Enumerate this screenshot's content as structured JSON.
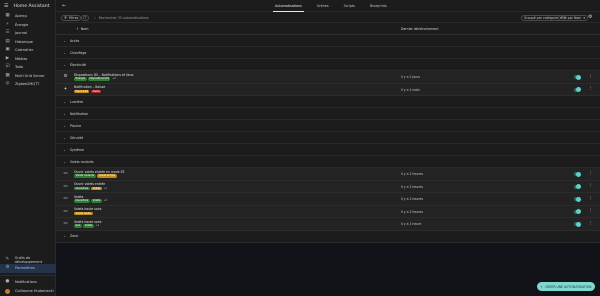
{
  "sidebar": {
    "title": "Home Assistant",
    "items": [
      {
        "label": "Aperçu",
        "icon": "view-dashboard-icon",
        "glyph": "▦"
      },
      {
        "label": "Énergie",
        "icon": "lightning-icon",
        "glyph": "⚡"
      },
      {
        "label": "Journal",
        "icon": "journal-icon",
        "glyph": "☰"
      },
      {
        "label": "Historique",
        "icon": "chart-icon",
        "glyph": "▤"
      },
      {
        "label": "Calendrier",
        "icon": "calendar-icon",
        "glyph": "▣"
      },
      {
        "label": "Médias",
        "icon": "media-icon",
        "glyph": "▶"
      },
      {
        "label": "Todo",
        "icon": "todo-icon",
        "glyph": "☑"
      },
      {
        "label": "Multi Grid Server",
        "icon": "grid-icon",
        "glyph": "▩"
      },
      {
        "label": "Zigbee2MQTT",
        "icon": "zigbee-icon",
        "glyph": "◎"
      }
    ],
    "bottom_items": [
      {
        "label": "Outils de développement",
        "icon": "wrench-icon",
        "glyph": "✎"
      },
      {
        "label": "Paramètres",
        "icon": "gear-icon",
        "glyph": "⚙",
        "active": true
      }
    ],
    "notifications": "Notifications",
    "user": "Guillaume Hudomecki"
  },
  "topbar": {
    "tabs": [
      "Automatisations",
      "Scènes",
      "Scripts",
      "Blueprints"
    ],
    "active_tab": 0
  },
  "filterbar": {
    "filters_label": "Filtres",
    "search_placeholder": "Rechercher 35 automatisations",
    "group_by": "Groupé par catégorie",
    "sort_by": "Trié par Nom"
  },
  "table": {
    "new_label": "Nom",
    "exec_header": "Dernier déclenchement"
  },
  "groups": [
    {
      "name": "Accès",
      "rows": []
    },
    {
      "name": "Chauffage",
      "rows": []
    },
    {
      "name": "Électricité",
      "rows": [
        {
          "name": "Dispositions DS – Notifications et lieux",
          "icon": "robot-icon",
          "glyph": "⚙",
          "chips": [
            {
              "label": "Énergie",
              "color": "#2e7d32"
            },
            {
              "label": "Dispositions DS",
              "color": "#2e7d32"
            }
          ],
          "more": "+2",
          "last": "Il y a 2 jours",
          "enabled": true
        },
        {
          "name": "Notification – Baisse",
          "icon": "lightbulb-icon",
          "glyph": "✦",
          "chips": [
            {
              "label": "Électricité",
              "color": "#c28a16"
            },
            {
              "label": "Alerte",
              "color": "#b3261e"
            }
          ],
          "more": "",
          "last": "Il y a 1 mois",
          "enabled": true
        }
      ]
    },
    {
      "name": "Lumière",
      "rows": []
    },
    {
      "name": "Notification",
      "rows": []
    },
    {
      "name": "Piscine",
      "rows": []
    },
    {
      "name": "Sécurité",
      "rows": []
    },
    {
      "name": "Système",
      "rows": []
    },
    {
      "name": "Volets roulants",
      "rows": [
        {
          "name": "Ouvrir volets entrée en mode ES",
          "icon": "window-shutter-icon",
          "glyph": "▭",
          "chips": [
            {
              "label": "Volets roulants",
              "color": "#2e7d32"
            },
            {
              "label": "Volets entrée",
              "color": "#c28a16"
            }
          ],
          "more": "",
          "last": "Il y a 2 heures",
          "enabled": true
        },
        {
          "name": "Ouvrir volets entrée",
          "icon": "window-shutter-icon",
          "glyph": "▭",
          "chips": [
            {
              "label": "Ouverture",
              "color": "#2e7d32"
            },
            {
              "label": "Volets",
              "color": "#c28a16"
            }
          ],
          "more": "+1",
          "last": "Il y a 2 heures",
          "enabled": true
        },
        {
          "name": "Volets",
          "icon": "window-shutter-icon",
          "glyph": "▭",
          "chips": [
            {
              "label": "Ouverture",
              "color": "#2e7d32"
            },
            {
              "label": "Volets",
              "color": "#2e7d32"
            }
          ],
          "more": "+2",
          "last": "Il y a 2 heures",
          "enabled": true
        },
        {
          "name": "Volets haute soirs",
          "icon": "window-shutter-icon",
          "glyph": "▭",
          "chips": [
            {
              "label": "Volets haute",
              "color": "#c28a16"
            }
          ],
          "more": "",
          "last": "Il y a 2 heures",
          "enabled": true
        },
        {
          "name": "Volets haute soirs",
          "icon": "window-shutter-icon",
          "glyph": "▭",
          "chips": [
            {
              "label": "Soir",
              "color": "#2e7d32"
            },
            {
              "label": "Volets",
              "color": "#2e7d32"
            }
          ],
          "more": "+2",
          "last": "Il y a 1 heure",
          "enabled": true
        }
      ]
    },
    {
      "name": "Zone",
      "rows": []
    }
  ],
  "fab": {
    "label": "CRÉER UNE AUTOMATISATION"
  }
}
